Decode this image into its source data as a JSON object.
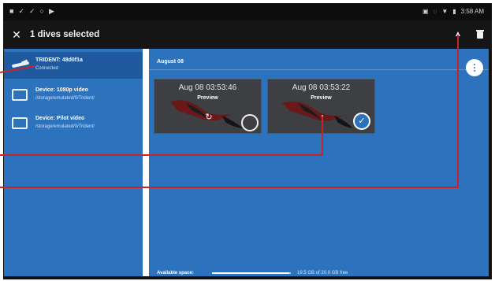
{
  "status_bar": {
    "left_icons": [
      "notification-icon",
      "check-icon",
      "check-icon",
      "circle-icon",
      "play-icon"
    ],
    "right_icons": [
      "message-icon",
      "sync-icon",
      "wifi-icon",
      "battery-icon"
    ],
    "time": "3:58 AM"
  },
  "action_bar": {
    "close_glyph": "✕",
    "title": "1 dives selected",
    "export_glyph": "▲"
  },
  "sidebar": {
    "devices": [
      {
        "name": "TRIDENT: 48d0f1a",
        "sub": "Connected",
        "icon": "drone-icon"
      },
      {
        "name": "Device: 1080p video",
        "sub": "/storage/emulated/0/Trident/",
        "icon": "tablet-icon"
      },
      {
        "name": "Device: Pilot video",
        "sub": "/storage/emulated/0/Trident/",
        "icon": "tablet-icon"
      }
    ]
  },
  "main": {
    "group_label": "August 08",
    "thumbnails": [
      {
        "time": "Aug 08 03:53:46",
        "preview": "Preview",
        "action_glyph": "↻",
        "selected": false
      },
      {
        "time": "Aug 08 03:53:22",
        "preview": "Preview",
        "action_glyph": "↑",
        "selected": true
      }
    ],
    "check_glyph": "✓",
    "storage": {
      "label": "Available space:",
      "text": "19.5 GB of 20.0 GB free",
      "fraction_free": 0.975
    }
  },
  "colors": {
    "accent": "#2d72bd",
    "selected_row": "#1f5a9e",
    "callout": "#c8232c",
    "toolbar": "#151515"
  }
}
